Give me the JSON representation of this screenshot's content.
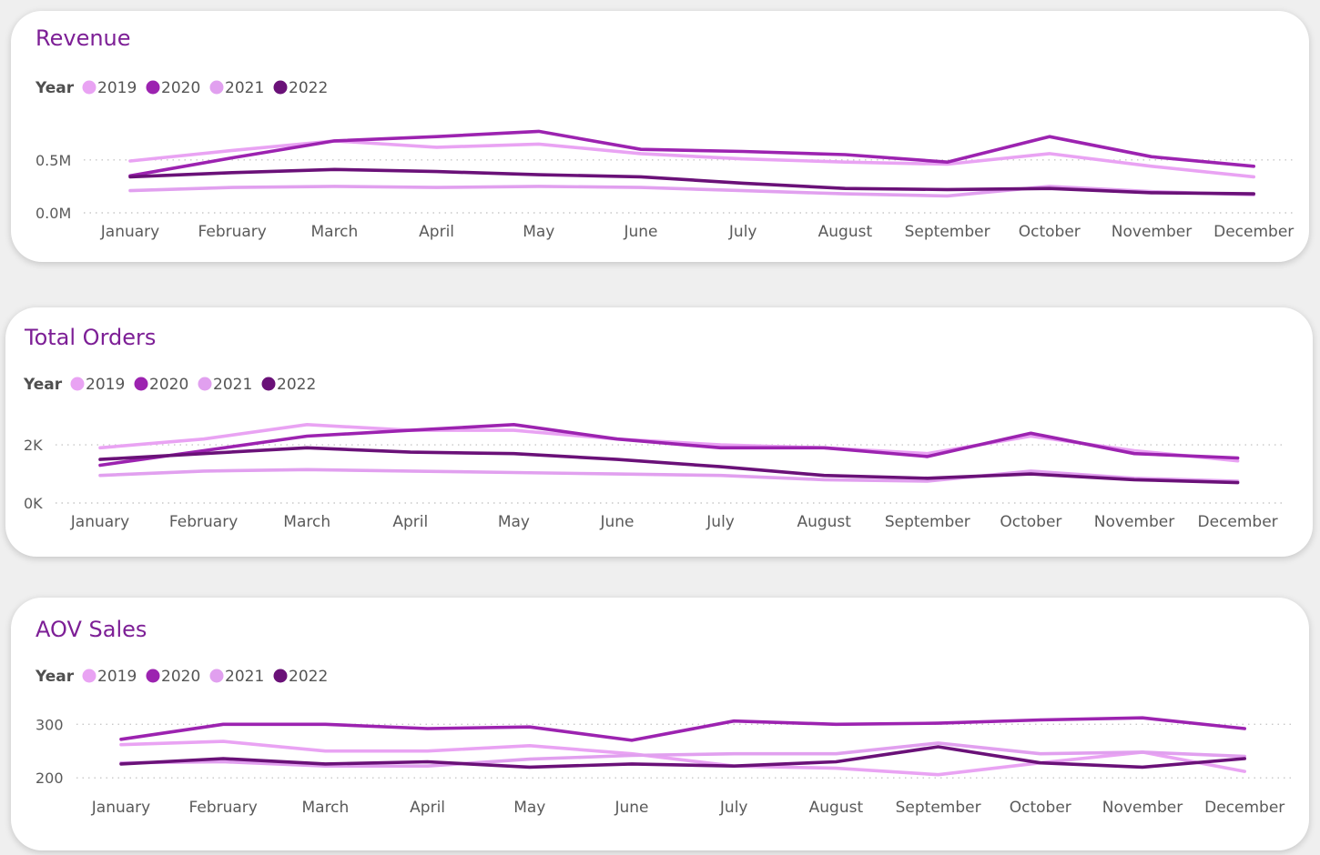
{
  "colors": {
    "2019": "#e9a3f3",
    "2020": "#9c23b0",
    "2021": "#e1a0ef",
    "2022": "#6a1178",
    "title": "#7d1f96"
  },
  "chart_data": [
    {
      "type": "line",
      "title": "Revenue",
      "legend_title": "Year",
      "categories": [
        "January",
        "February",
        "March",
        "April",
        "May",
        "June",
        "July",
        "August",
        "September",
        "October",
        "November",
        "December"
      ],
      "y_ticks": [
        {
          "value": 0,
          "label": "0.0M"
        },
        {
          "value": 0.5,
          "label": "0.5M"
        }
      ],
      "ylim": [
        0,
        0.98
      ],
      "series": [
        {
          "name": "2019",
          "color_key": "2019",
          "values": [
            0.49,
            0.59,
            0.68,
            0.62,
            0.65,
            0.56,
            0.51,
            0.48,
            0.46,
            0.56,
            0.44,
            0.34
          ]
        },
        {
          "name": "2020",
          "color_key": "2020",
          "values": [
            0.35,
            0.52,
            0.68,
            0.72,
            0.77,
            0.6,
            0.58,
            0.55,
            0.48,
            0.72,
            0.53,
            0.44
          ]
        },
        {
          "name": "2021",
          "color_key": "2021",
          "values": [
            0.21,
            0.24,
            0.25,
            0.24,
            0.25,
            0.24,
            0.21,
            0.18,
            0.16,
            0.25,
            0.2,
            0.17
          ]
        },
        {
          "name": "2022",
          "color_key": "2022",
          "values": [
            0.34,
            0.38,
            0.41,
            0.39,
            0.36,
            0.34,
            0.28,
            0.23,
            0.22,
            0.23,
            0.19,
            0.18
          ]
        }
      ]
    },
    {
      "type": "line",
      "title": "Total Orders",
      "legend_title": "Year",
      "categories": [
        "January",
        "February",
        "March",
        "April",
        "May",
        "June",
        "July",
        "August",
        "September",
        "October",
        "November",
        "December"
      ],
      "y_ticks": [
        {
          "value": 0,
          "label": "0K"
        },
        {
          "value": 2000,
          "label": "2K"
        }
      ],
      "ylim": [
        0,
        3600
      ],
      "series": [
        {
          "name": "2019",
          "color_key": "2019",
          "values": [
            1900,
            2200,
            2700,
            2500,
            2500,
            2200,
            2000,
            1900,
            1700,
            2300,
            1800,
            1450
          ]
        },
        {
          "name": "2020",
          "color_key": "2020",
          "values": [
            1300,
            1800,
            2300,
            2500,
            2700,
            2200,
            1900,
            1900,
            1600,
            2400,
            1700,
            1550
          ]
        },
        {
          "name": "2021",
          "color_key": "2021",
          "values": [
            950,
            1100,
            1150,
            1100,
            1050,
            1000,
            950,
            800,
            750,
            1100,
            850,
            750
          ]
        },
        {
          "name": "2022",
          "color_key": "2022",
          "values": [
            1500,
            1700,
            1900,
            1750,
            1700,
            1500,
            1250,
            950,
            850,
            1000,
            800,
            700
          ]
        }
      ]
    },
    {
      "type": "line",
      "title": "AOV Sales",
      "legend_title": "Year",
      "categories": [
        "January",
        "February",
        "March",
        "April",
        "May",
        "June",
        "July",
        "August",
        "September",
        "October",
        "November",
        "December"
      ],
      "y_ticks": [
        {
          "value": 200,
          "label": "200"
        },
        {
          "value": 300,
          "label": "300"
        }
      ],
      "ylim": [
        180,
        370
      ],
      "series": [
        {
          "name": "2019",
          "color_key": "2019",
          "values": [
            262,
            268,
            250,
            250,
            260,
            245,
            222,
            218,
            206,
            228,
            248,
            212
          ]
        },
        {
          "name": "2020",
          "color_key": "2020",
          "values": [
            272,
            300,
            300,
            292,
            295,
            270,
            306,
            300,
            302,
            308,
            312,
            292
          ]
        },
        {
          "name": "2021",
          "color_key": "2021",
          "values": [
            228,
            230,
            222,
            222,
            235,
            242,
            245,
            245,
            265,
            245,
            248,
            240
          ]
        },
        {
          "name": "2022",
          "color_key": "2022",
          "values": [
            226,
            236,
            226,
            230,
            220,
            226,
            222,
            230,
            258,
            228,
            220,
            236
          ]
        }
      ]
    }
  ]
}
